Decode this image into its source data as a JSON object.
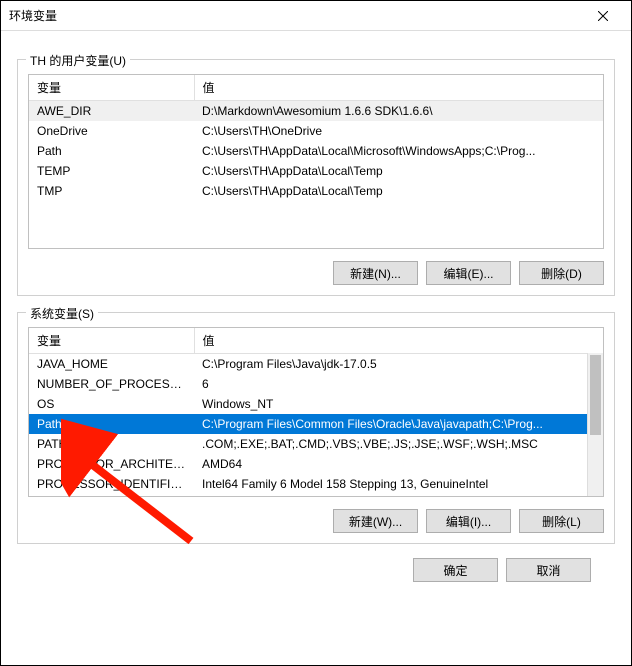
{
  "window": {
    "title": "环境变量"
  },
  "user_vars": {
    "group_label": "TH 的用户变量(U)",
    "columns": {
      "var": "变量",
      "val": "值"
    },
    "rows": [
      {
        "var": "AWE_DIR",
        "val": "D:\\Markdown\\Awesomium 1.6.6 SDK\\1.6.6\\"
      },
      {
        "var": "OneDrive",
        "val": "C:\\Users\\TH\\OneDrive"
      },
      {
        "var": "Path",
        "val": "C:\\Users\\TH\\AppData\\Local\\Microsoft\\WindowsApps;C:\\Prog..."
      },
      {
        "var": "TEMP",
        "val": "C:\\Users\\TH\\AppData\\Local\\Temp"
      },
      {
        "var": "TMP",
        "val": "C:\\Users\\TH\\AppData\\Local\\Temp"
      }
    ],
    "buttons": {
      "new": "新建(N)...",
      "edit": "编辑(E)...",
      "delete": "删除(D)"
    }
  },
  "sys_vars": {
    "group_label": "系统变量(S)",
    "columns": {
      "var": "变量",
      "val": "值"
    },
    "rows": [
      {
        "var": "JAVA_HOME",
        "val": "C:\\Program Files\\Java\\jdk-17.0.5"
      },
      {
        "var": "NUMBER_OF_PROCESSORS",
        "val": "6"
      },
      {
        "var": "OS",
        "val": "Windows_NT"
      },
      {
        "var": "Path",
        "val": "C:\\Program Files\\Common Files\\Oracle\\Java\\javapath;C:\\Prog..."
      },
      {
        "var": "PATHEXT",
        "val": ".COM;.EXE;.BAT;.CMD;.VBS;.VBE;.JS;.JSE;.WSF;.WSH;.MSC"
      },
      {
        "var": "PROCESSOR_ARCHITECT...",
        "val": "AMD64"
      },
      {
        "var": "PROCESSOR_IDENTIFIER",
        "val": "Intel64 Family 6 Model 158 Stepping 13, GenuineIntel"
      }
    ],
    "selected_row_index": 3,
    "buttons": {
      "new": "新建(W)...",
      "edit": "编辑(I)...",
      "delete": "删除(L)"
    }
  },
  "dialog_buttons": {
    "ok": "确定",
    "cancel": "取消"
  }
}
